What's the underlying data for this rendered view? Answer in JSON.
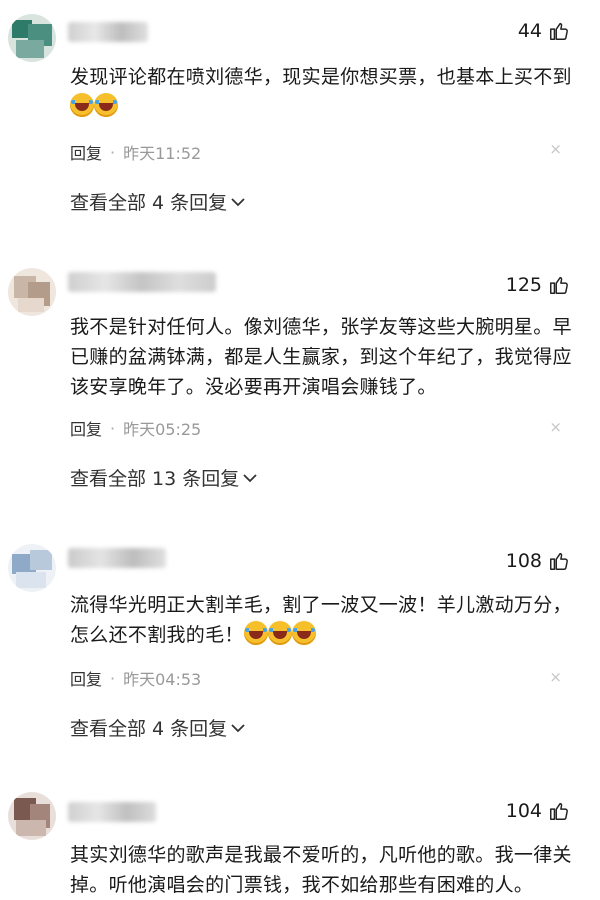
{
  "comments": [
    {
      "likes": "44",
      "text_parts": [
        "发现评论都在喷刘德华，现实是你想买票，也基本上买不到"
      ],
      "emoji_count": 2,
      "reply_label": "回复",
      "separator": "·",
      "time": "昨天11:52",
      "close": "×",
      "view_more": "查看全部 4 条回复",
      "avatar_colors": [
        "#2e7b6a",
        "#7aa9a0"
      ]
    },
    {
      "likes": "125",
      "text_parts": [
        "我不是针对任何人。像刘德华，张学友等这些大腕明星。早已赚的盆满钵满，都是人生赢家，到这个年纪了，我觉得应该安享晚年了。没必要再开演唱会赚钱了。"
      ],
      "emoji_count": 0,
      "reply_label": "回复",
      "separator": "·",
      "time": "昨天05:25",
      "close": "×",
      "view_more": "查看全部 13 条回复",
      "avatar_colors": [
        "#c9b6a6",
        "#e6d8cc"
      ]
    },
    {
      "likes": "108",
      "text_parts": [
        "流得华光明正大割羊毛，割了一波又一波！羊儿激动万分，怎么还不割我的毛！"
      ],
      "emoji_count": 3,
      "reply_label": "回复",
      "separator": "·",
      "time": "昨天04:53",
      "close": "×",
      "view_more": "查看全部 4 条回复",
      "avatar_colors": [
        "#8fa9c8",
        "#dbe4ee"
      ]
    },
    {
      "likes": "104",
      "text_parts": [
        "其实刘德华的歌声是我最不爱听的，凡听他的歌。我一律关掉。听他演唱会的门票钱，我不如给那些有困难的人。"
      ],
      "emoji_count": 0,
      "avatar_colors": [
        "#7a5a50",
        "#cbb7ae"
      ]
    }
  ],
  "icons": {
    "like": "thumbs-up-outline-icon",
    "chevron": "chevron-down-icon",
    "emoji": "laughing-crying-emoji-icon"
  }
}
